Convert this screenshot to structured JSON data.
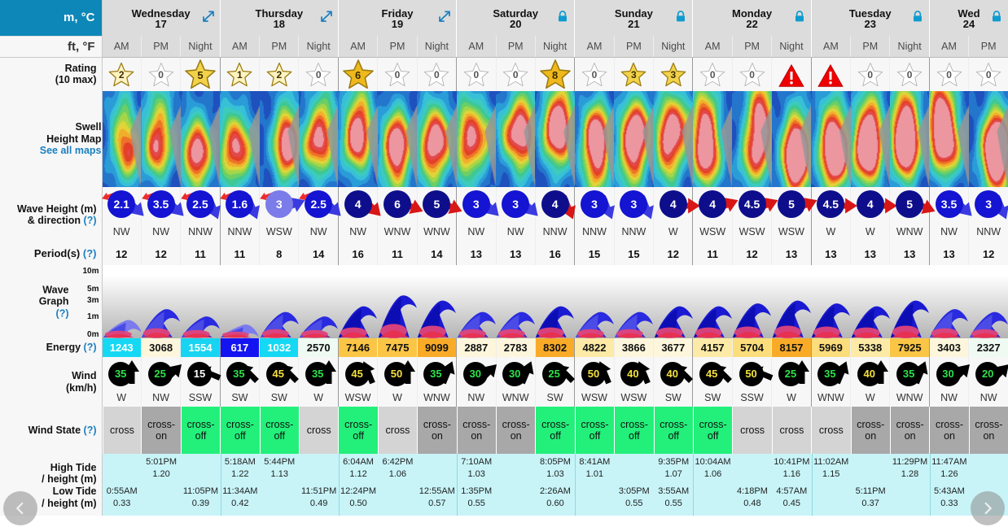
{
  "units": {
    "metric": "m, °C",
    "imperial": "ft, °F"
  },
  "labels": {
    "rating": "Rating",
    "rating_sub": "(10 max)",
    "swell_map_1": "Swell",
    "swell_map_2": "Height Map",
    "swell_map_link": "See all maps",
    "wave_height_1": "Wave Height (m)",
    "wave_height_2": "& direction",
    "period": "Period(s)",
    "wave_graph_1": "Wave",
    "wave_graph_2": "Graph",
    "energy": "Energy",
    "wind_1": "Wind",
    "wind_2": "(km/h)",
    "wind_state": "Wind State",
    "high_tide_1": "High Tide",
    "high_tide_2": "/ height (m)",
    "low_tide_1": "Low Tide",
    "low_tide_2": "/ height (m)",
    "help": "(?)"
  },
  "axis": {
    "ticks": [
      "10m",
      "5m",
      "3m",
      "1m",
      "0m"
    ]
  },
  "days": [
    {
      "name": "Wednesday",
      "date": "17",
      "badge": "expand-icon",
      "slots": [
        "AM",
        "PM",
        "Night"
      ]
    },
    {
      "name": "Thursday",
      "date": "18",
      "badge": "expand-icon",
      "slots": [
        "AM",
        "PM",
        "Night"
      ]
    },
    {
      "name": "Friday",
      "date": "19",
      "badge": "expand-icon",
      "slots": [
        "AM",
        "PM",
        "Night"
      ]
    },
    {
      "name": "Saturday",
      "date": "20",
      "badge": "lock-icon",
      "slots": [
        "AM",
        "PM",
        "Night"
      ]
    },
    {
      "name": "Sunday",
      "date": "21",
      "badge": "lock-icon",
      "slots": [
        "AM",
        "PM",
        "Night"
      ]
    },
    {
      "name": "Monday",
      "date": "22",
      "badge": "lock-icon",
      "slots": [
        "AM",
        "PM",
        "Night"
      ]
    },
    {
      "name": "Tuesday",
      "date": "23",
      "badge": "lock-icon",
      "slots": [
        "AM",
        "PM",
        "Night"
      ]
    },
    {
      "name": "Wed",
      "date": "24",
      "badge": "lock-icon",
      "slots": [
        "AM",
        "PM"
      ]
    }
  ],
  "chart_data": {
    "type": "table",
    "title": "Surf forecast table",
    "columns": [
      "Wed 17 AM",
      "Wed 17 PM",
      "Wed 17 Night",
      "Thu 18 AM",
      "Thu 18 PM",
      "Thu 18 Night",
      "Fri 19 AM",
      "Fri 19 PM",
      "Fri 19 Night",
      "Sat 20 AM",
      "Sat 20 PM",
      "Sat 20 Night",
      "Sun 21 AM",
      "Sun 21 PM",
      "Sun 21 Night",
      "Mon 22 AM",
      "Mon 22 PM",
      "Mon 22 Night",
      "Tue 23 AM",
      "Tue 23 PM",
      "Tue 23 Night",
      "Wed 24 AM",
      "Wed 24 PM"
    ],
    "rating": [
      {
        "value": "2",
        "filled": true
      },
      {
        "value": "0",
        "filled": false
      },
      {
        "value": "5",
        "filled": true
      },
      {
        "value": "1",
        "filled": true
      },
      {
        "value": "2",
        "filled": true
      },
      {
        "value": "0",
        "filled": false
      },
      {
        "value": "6",
        "filled": true
      },
      {
        "value": "0",
        "filled": false
      },
      {
        "value": "0",
        "filled": false
      },
      {
        "value": "0",
        "filled": false
      },
      {
        "value": "0",
        "filled": false
      },
      {
        "value": "8",
        "filled": true
      },
      {
        "value": "0",
        "filled": false
      },
      {
        "value": "3",
        "filled": true
      },
      {
        "value": "3",
        "filled": true
      },
      {
        "value": "0",
        "filled": false
      },
      {
        "value": "0",
        "filled": false
      },
      {
        "value": "!",
        "filled": false,
        "warning": true
      },
      {
        "value": "!",
        "filled": false,
        "warning": true
      },
      {
        "value": "0",
        "filled": false
      },
      {
        "value": "0",
        "filled": false
      },
      {
        "value": "0",
        "filled": false
      },
      {
        "value": "0",
        "filled": false
      }
    ],
    "wave_height": [
      "2.1",
      "3.5",
      "2.5",
      "1.6",
      "3",
      "2.5",
      "4",
      "6",
      "5",
      "3",
      "3",
      "4",
      "3",
      "3",
      "4",
      "4",
      "4.5",
      "5",
      "4.5",
      "4",
      "5",
      "3.5",
      "3"
    ],
    "wave_direction": [
      "NW",
      "NW",
      "NNW",
      "NNW",
      "WSW",
      "NW",
      "NW",
      "WNW",
      "WNW",
      "NW",
      "NW",
      "NNW",
      "NNW",
      "NNW",
      "W",
      "WSW",
      "WSW",
      "WSW",
      "W",
      "W",
      "WNW",
      "NW",
      "NNW"
    ],
    "period": [
      "12",
      "12",
      "11",
      "11",
      "8",
      "14",
      "16",
      "11",
      "14",
      "13",
      "13",
      "16",
      "15",
      "15",
      "12",
      "11",
      "12",
      "13",
      "13",
      "13",
      "13",
      "13",
      "12"
    ],
    "energy": [
      "1243",
      "3068",
      "1554",
      "617",
      "1032",
      "2570",
      "7146",
      "7475",
      "9099",
      "2887",
      "2783",
      "8302",
      "4822",
      "3866",
      "3677",
      "4157",
      "5704",
      "8157",
      "5969",
      "5338",
      "7925",
      "3403",
      "2327"
    ],
    "wind_speed": [
      "35",
      "25",
      "15",
      "35",
      "45",
      "35",
      "45",
      "50",
      "35",
      "30",
      "30",
      "25",
      "50",
      "40",
      "40",
      "45",
      "50",
      "25",
      "35",
      "40",
      "35",
      "30",
      "20"
    ],
    "wind_direction": [
      "W",
      "NW",
      "SSW",
      "SW",
      "SW",
      "W",
      "WSW",
      "W",
      "WNW",
      "NW",
      "WNW",
      "SW",
      "WSW",
      "WSW",
      "SW",
      "SW",
      "SSW",
      "W",
      "WNW",
      "W",
      "WNW",
      "NW",
      "NW"
    ],
    "wind_state": [
      "cross",
      "cross-on",
      "cross-off",
      "cross-off",
      "cross-off",
      "cross",
      "cross-off",
      "cross",
      "cross-on",
      "cross-on",
      "cross-on",
      "cross-off",
      "cross-off",
      "cross-off",
      "cross-off",
      "cross-off",
      "cross",
      "cross",
      "cross",
      "cross-on",
      "cross-on",
      "cross-on",
      "cross-on"
    ],
    "high_tides": [
      {
        "col": 1,
        "time": "5:01PM",
        "height": "1.20"
      },
      {
        "col": 3,
        "time": "5:18AM",
        "height": "1.22"
      },
      {
        "col": 4,
        "time": "5:44PM",
        "height": "1.13"
      },
      {
        "col": 6,
        "time": "6:04AM",
        "height": "1.12"
      },
      {
        "col": 7,
        "time": "6:42PM",
        "height": "1.06"
      },
      {
        "col": 9,
        "time": "7:10AM",
        "height": "1.03"
      },
      {
        "col": 11,
        "time": "8:05PM",
        "height": "1.03"
      },
      {
        "col": 12,
        "time": "8:41AM",
        "height": "1.01"
      },
      {
        "col": 14,
        "time": "9:35PM",
        "height": "1.07"
      },
      {
        "col": 15,
        "time": "10:04AM",
        "height": "1.06"
      },
      {
        "col": 17,
        "time": "10:41PM",
        "height": "1.16"
      },
      {
        "col": 18,
        "time": "11:02AM",
        "height": "1.15"
      },
      {
        "col": 20,
        "time": "11:29PM",
        "height": "1.28"
      },
      {
        "col": 21,
        "time": "11:47AM",
        "height": "1.26"
      }
    ],
    "low_tides": [
      {
        "col": 0,
        "time": "0:55AM",
        "height": "0.33"
      },
      {
        "col": 2,
        "time": "11:05PM",
        "height": "0.39"
      },
      {
        "col": 3,
        "time": "11:34AM",
        "height": "0.42"
      },
      {
        "col": 5,
        "time": "11:51PM",
        "height": "0.49"
      },
      {
        "col": 6,
        "time": "12:24PM",
        "height": "0.50"
      },
      {
        "col": 8,
        "time": "12:55AM",
        "height": "0.57"
      },
      {
        "col": 9,
        "time": "1:35PM",
        "height": "0.55"
      },
      {
        "col": 11,
        "time": "2:26AM",
        "height": "0.60"
      },
      {
        "col": 13,
        "time": "3:05PM",
        "height": "0.55"
      },
      {
        "col": 14,
        "time": "3:55AM",
        "height": "0.55"
      },
      {
        "col": 16,
        "time": "4:18PM",
        "height": "0.48"
      },
      {
        "col": 17,
        "time": "4:57AM",
        "height": "0.45"
      },
      {
        "col": 19,
        "time": "5:11PM",
        "height": "0.37"
      },
      {
        "col": 21,
        "time": "5:43AM",
        "height": "0.33"
      }
    ],
    "wave_graph_heights": [
      2.1,
      3.5,
      2.5,
      1.6,
      3.0,
      2.5,
      4.0,
      6.0,
      5.0,
      3.0,
      3.0,
      4.0,
      3.0,
      3.0,
      4.0,
      4.0,
      4.5,
      5.0,
      4.5,
      4.0,
      5.0,
      3.5,
      3.0
    ],
    "ylabel": "Wave height (m)",
    "ylim": [
      0,
      10
    ]
  },
  "colors": {
    "accent": "#0c87b8",
    "link": "#1a7fc1",
    "star_on": "#f2c029",
    "star_off": "#ffffff",
    "warning": "#ee0000",
    "swell_circle": "#1414d2",
    "wind_circle": "#000000",
    "crossoff": "#22f07a",
    "crosson": "#a8a8a8",
    "cross": "#d4d4d4",
    "tide_bg": "#c8f4f8"
  },
  "scroll": {
    "left": "prev-arrow",
    "right": "next-arrow"
  }
}
